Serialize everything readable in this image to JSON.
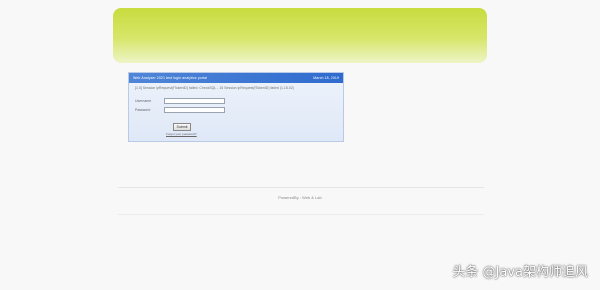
{
  "panel": {
    "header_title": "Web Analyzer 2021 test login analytics portal",
    "header_date": "March 18, 2019",
    "notice": "[1.0] Session ipRequest(fTokenID) failed: CheckSQL - 15 Session ipRequest(fTokenID) failed (1.15.02)"
  },
  "login": {
    "username_label": "Username",
    "password_label": "Password",
    "username_value": "",
    "password_value": "",
    "submit_label": "Submit",
    "help_link": "Forgot your password?"
  },
  "footer": {
    "text": "PoweredBy : Web & Lab"
  },
  "watermark": {
    "text": "头条 @Java架构师追风"
  }
}
